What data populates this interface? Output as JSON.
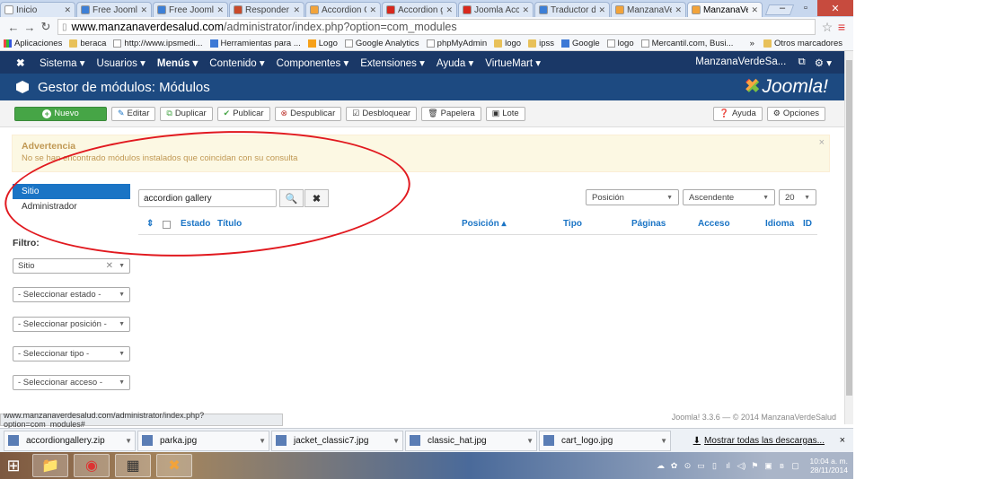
{
  "browser": {
    "tabs": [
      {
        "label": "Inicio",
        "color": "#ffffff"
      },
      {
        "label": "Free Joomla",
        "color": "#3d7fd6"
      },
      {
        "label": "Free Joomla",
        "color": "#3d7fd6"
      },
      {
        "label": "Responder T",
        "color": "#c94a2b"
      },
      {
        "label": "Accordion G",
        "color": "#f2a33a"
      },
      {
        "label": "Accordion g",
        "color": "#d8281e"
      },
      {
        "label": "Joomla Acco",
        "color": "#d8281e"
      },
      {
        "label": "Traductor de",
        "color": "#3d7fd6"
      },
      {
        "label": "ManzanaVer",
        "color": "#f2a33a"
      },
      {
        "label": "ManzanaVer",
        "color": "#f2a33a"
      }
    ],
    "url_host": "www.manzanaverdesalud.com",
    "url_path": "/administrator/index.php?option=com_modules",
    "bookmarks": [
      {
        "label": "Aplicaciones",
        "icon": "grid"
      },
      {
        "label": "beraca",
        "icon": "folder"
      },
      {
        "label": "http://www.ipsmedi...",
        "icon": "page"
      },
      {
        "label": "Herramientas para ...",
        "icon": "g"
      },
      {
        "label": "Logo",
        "icon": "ga"
      },
      {
        "label": "Google Analytics",
        "icon": "page"
      },
      {
        "label": "phpMyAdmin",
        "icon": "page"
      },
      {
        "label": "logo",
        "icon": "folder"
      },
      {
        "label": "ipss",
        "icon": "folder"
      },
      {
        "label": "Google",
        "icon": "g"
      },
      {
        "label": "logo",
        "icon": "page"
      },
      {
        "label": "Mercantil.com, Busi...",
        "icon": "page"
      }
    ],
    "bookmarks_overflow": "»",
    "other_bookmarks": "Otros marcadores"
  },
  "joomla": {
    "menu": [
      "Sistema ▾",
      "Usuarios ▾",
      "Menús ▾",
      "Contenido ▾",
      "Componentes ▾",
      "Extensiones ▾",
      "Ayuda ▾",
      "VirtueMart ▾"
    ],
    "site_name": "ManzanaVerdeSa...",
    "page_title": "Gestor de módulos: Módulos",
    "brand": "Joomla!",
    "toolbar": {
      "new": "Nuevo",
      "edit": "Editar",
      "duplicate": "Duplicar",
      "publish": "Publicar",
      "unpublish": "Despublicar",
      "checkin": "Desbloquear",
      "trash": "Papelera",
      "batch": "Lote",
      "help": "Ayuda",
      "options": "Opciones"
    },
    "alert": {
      "heading": "Advertencia",
      "message": "No se han encontrado módulos instalados que coincidan con su consulta"
    },
    "sidebar": {
      "items": [
        {
          "label": "Sitio",
          "active": true
        },
        {
          "label": "Administrador",
          "active": false
        }
      ],
      "filter_label": "Filtro:",
      "filters": [
        "Sitio",
        "- Seleccionar estado -",
        "- Seleccionar posición -",
        "- Seleccionar tipo -",
        "- Seleccionar acceso -"
      ]
    },
    "search": {
      "value": "accordion gallery"
    },
    "list_controls": {
      "ordering": "Posición",
      "direction": "Ascendente",
      "limit": "20"
    },
    "columns": [
      "Estado",
      "Título",
      "Posición ▴",
      "Tipo",
      "Páginas",
      "Acceso",
      "Idioma",
      "ID"
    ],
    "footer": "Joomla! 3.3.6 — © 2014 ManzanaVerdeSalud"
  },
  "status_url": "www.manzanaverdesalud.com/administrator/index.php?option=com_modules#",
  "downloads": {
    "items": [
      "accordiongallery.zip",
      "parka.jpg",
      "jacket_classic7.jpg",
      "classic_hat.jpg",
      "cart_logo.jpg"
    ],
    "show_all": "Mostrar todas las descargas...",
    "close": "×"
  },
  "taskbar": {
    "time": "10:04 a. m.",
    "date": "28/11/2014"
  }
}
